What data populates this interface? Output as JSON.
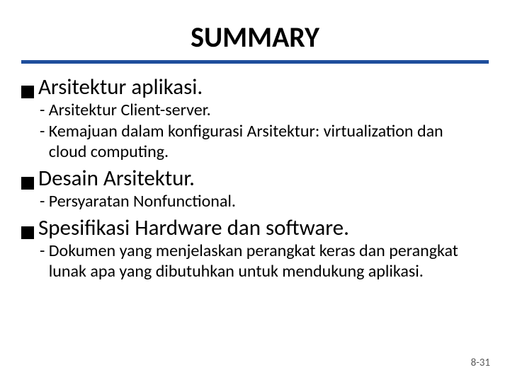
{
  "title": "SUMMARY",
  "sections": [
    {
      "heading": "Arsitektur aplikasi.",
      "subs": [
        {
          "dash": "- ",
          "text": "Arsitektur Client-server."
        },
        {
          "dash": "- ",
          "text": "Kemajuan dalam konfigurasi Arsitektur: virtualization dan cloud computing."
        }
      ]
    },
    {
      "heading": "Desain Arsitektur.",
      "subs": [
        {
          "dash": "- ",
          "text": "Persyaratan Nonfunctional."
        }
      ]
    },
    {
      "heading": "Spesifikasi Hardware dan software.",
      "subs": [
        {
          "dash": "- ",
          "text": "Dokumen yang menjelaskan perangkat keras dan perangkat lunak apa yang dibutuhkan untuk mendukung aplikasi."
        }
      ]
    }
  ],
  "footer": "8-31"
}
